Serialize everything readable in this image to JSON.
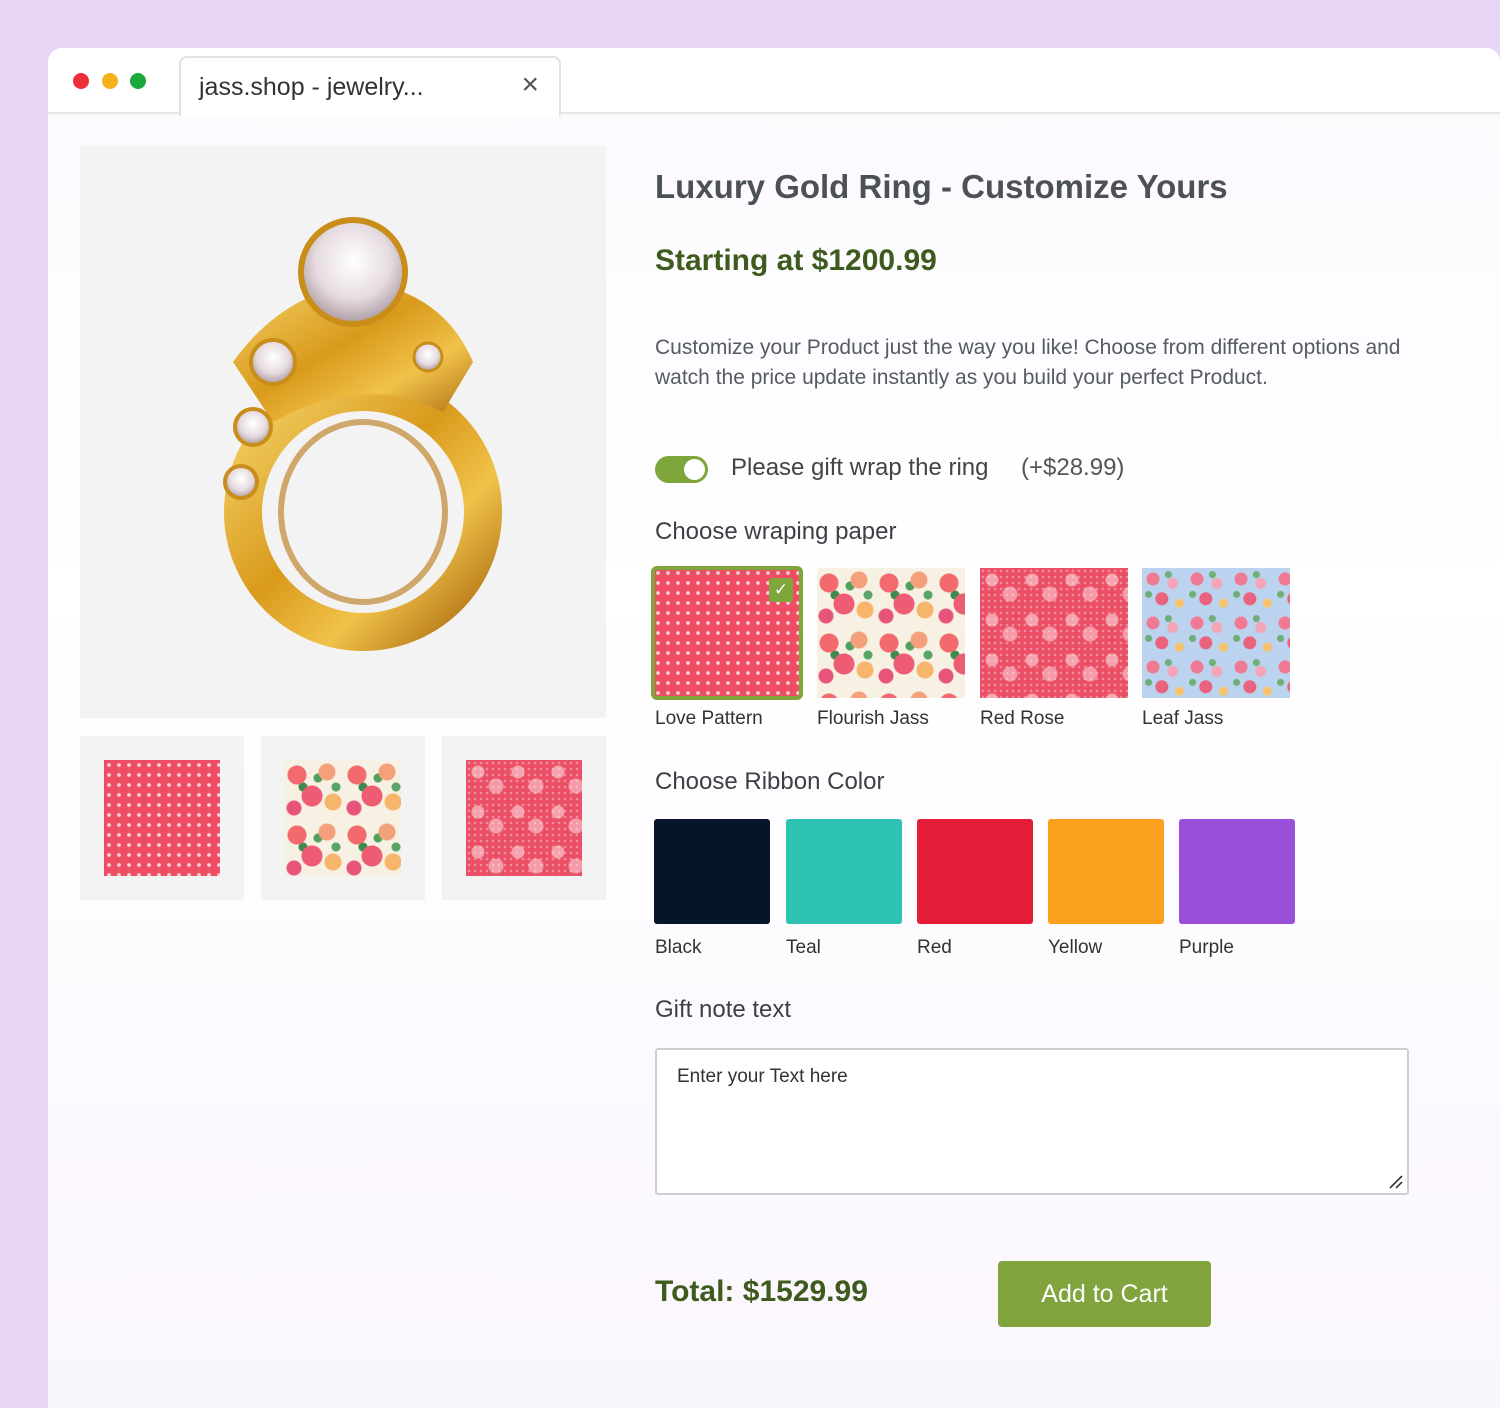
{
  "browser": {
    "tab_title": "jass.shop - jewelry...",
    "close_glyph": "×"
  },
  "product": {
    "title": "Luxury Gold Ring - Customize Yours",
    "price_label": "Starting at $1200.99",
    "description": "Customize your Product just the way you like! Choose from different options and watch the price update instantly as you build your perfect Product.",
    "image_icon": "gold-ring-image"
  },
  "gift_wrap": {
    "label": "Please gift wrap the ring",
    "price": "(+$28.99)",
    "enabled": true
  },
  "wrapping_paper": {
    "title": "Choose wraping paper",
    "options": [
      {
        "label": "Love Pattern",
        "selected": true
      },
      {
        "label": "Flourish Jass",
        "selected": false
      },
      {
        "label": "Red Rose",
        "selected": false
      },
      {
        "label": "Leaf Jass",
        "selected": false
      }
    ],
    "check_glyph": "✓"
  },
  "ribbon": {
    "title": "Choose Ribbon Color",
    "options": [
      {
        "label": "Black",
        "color": "#06152a"
      },
      {
        "label": "Teal",
        "color": "#2ec2b3"
      },
      {
        "label": "Red",
        "color": "#e51c38"
      },
      {
        "label": "Yellow",
        "color": "#f9a11f"
      },
      {
        "label": "Purple",
        "color": "#9a4fd9"
      }
    ]
  },
  "gift_note": {
    "title": "Gift note text",
    "placeholder": "Enter your Text here"
  },
  "footer": {
    "total": "Total: $1529.99",
    "add_to_cart": "Add to Cart"
  },
  "colors": {
    "accent": "#82a43e",
    "price_text": "#3f5a1d",
    "background": "#e8d6f7"
  }
}
